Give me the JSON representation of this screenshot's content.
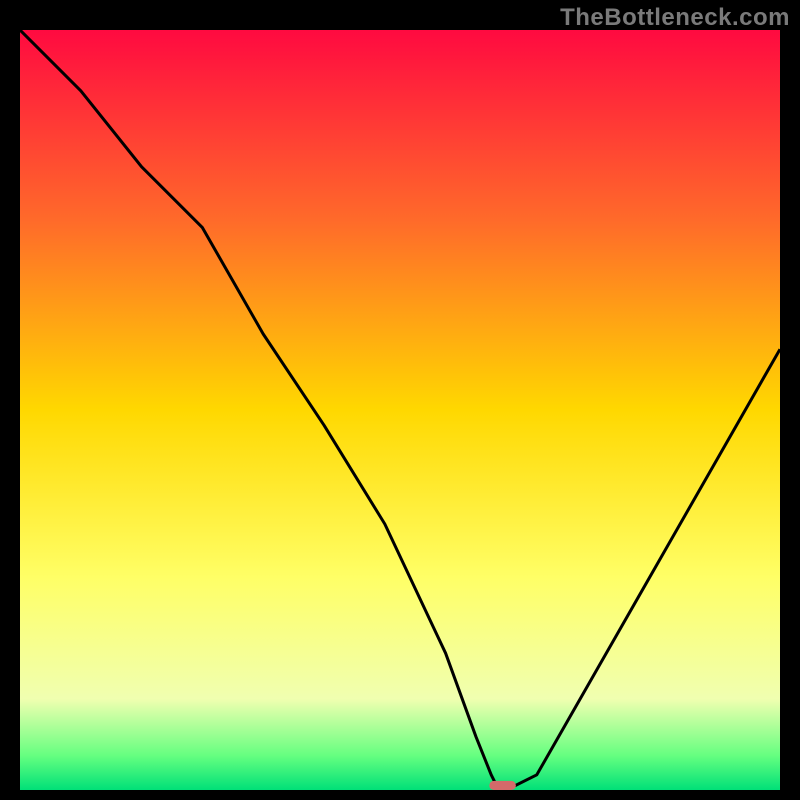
{
  "watermark": "TheBottleneck.com",
  "chart_data": {
    "type": "line",
    "title": "",
    "xlabel": "",
    "ylabel": "",
    "xlim": [
      0,
      100
    ],
    "ylim": [
      0,
      100
    ],
    "grid": false,
    "legend": false,
    "background_gradient": {
      "stops": [
        {
          "pos": 0.0,
          "color": "#ff0a40"
        },
        {
          "pos": 0.25,
          "color": "#ff6a2a"
        },
        {
          "pos": 0.5,
          "color": "#ffd800"
        },
        {
          "pos": 0.72,
          "color": "#ffff66"
        },
        {
          "pos": 0.88,
          "color": "#f0ffb0"
        },
        {
          "pos": 0.955,
          "color": "#65ff80"
        },
        {
          "pos": 1.0,
          "color": "#00e078"
        }
      ]
    },
    "series": [
      {
        "name": "bottleneck-curve",
        "color": "#000000",
        "x": [
          0,
          8,
          16,
          24,
          32,
          40,
          48,
          56,
          60,
          62,
          63,
          64,
          68,
          76,
          84,
          92,
          100
        ],
        "y": [
          100,
          92,
          82,
          74,
          60,
          48,
          35,
          18,
          7,
          2,
          0,
          0,
          2,
          16,
          30,
          44,
          58
        ]
      }
    ],
    "marker": {
      "name": "optimal-point",
      "x": 63.5,
      "y": 0,
      "width": 3.5,
      "height": 1.2,
      "color": "#d46a6a"
    }
  }
}
